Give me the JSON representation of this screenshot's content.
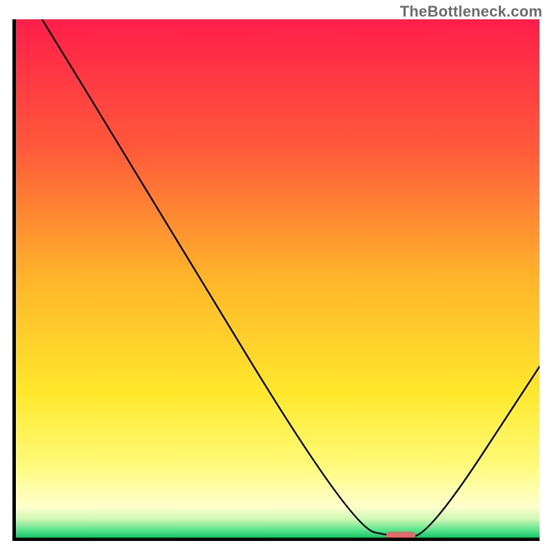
{
  "watermark": "TheBottleneck.com",
  "chart_data": {
    "type": "line",
    "title": "",
    "xlabel": "",
    "ylabel": "",
    "xlim": [
      0,
      1
    ],
    "ylim": [
      0,
      1
    ],
    "grid": false,
    "background": "vertical-gradient",
    "gradient_stops": [
      {
        "pos": 0.0,
        "color": "#ff1e4a"
      },
      {
        "pos": 0.25,
        "color": "#ff5a3a"
      },
      {
        "pos": 0.5,
        "color": "#ffb52a"
      },
      {
        "pos": 0.72,
        "color": "#ffe82c"
      },
      {
        "pos": 0.86,
        "color": "#fffb7a"
      },
      {
        "pos": 0.94,
        "color": "#ffffcc"
      },
      {
        "pos": 0.965,
        "color": "#ccf8b4"
      },
      {
        "pos": 0.985,
        "color": "#5ae68e"
      },
      {
        "pos": 1.0,
        "color": "#18c667"
      }
    ],
    "series": [
      {
        "name": "bottleneck-curve",
        "x": [
          0.05,
          0.22,
          0.64,
          0.73,
          0.79,
          1.0
        ],
        "y": [
          1.0,
          0.72,
          0.02,
          0.0,
          0.005,
          0.33
        ]
      }
    ],
    "annotations": [
      {
        "name": "optimal-marker",
        "type": "pill",
        "x": 0.735,
        "y": 0.004,
        "color": "#e06a6e"
      }
    ]
  }
}
